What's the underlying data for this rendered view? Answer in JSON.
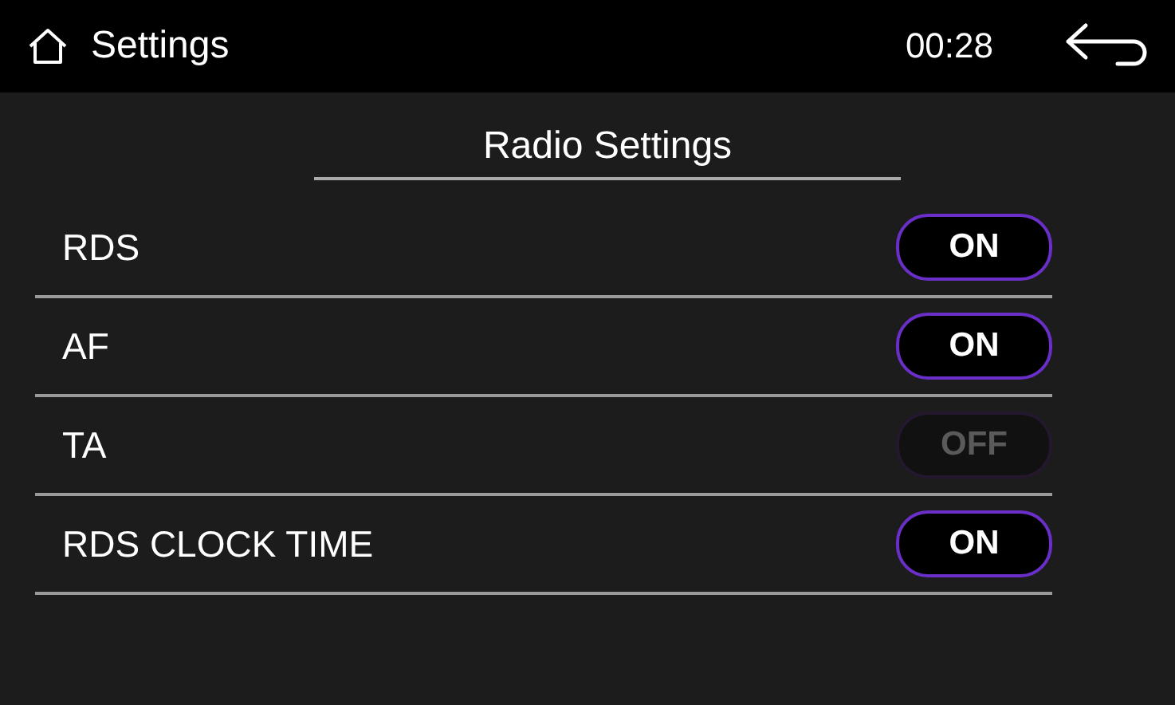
{
  "header": {
    "title": "Settings",
    "time": "00:28"
  },
  "section_title": "Radio Settings",
  "settings": [
    {
      "label": "RDS",
      "toggle": "ON",
      "on": true
    },
    {
      "label": "AF",
      "toggle": "ON",
      "on": true
    },
    {
      "label": "TA",
      "toggle": "OFF",
      "on": false
    },
    {
      "label": "RDS  CLOCK  TIME",
      "toggle": "ON",
      "on": true
    }
  ]
}
